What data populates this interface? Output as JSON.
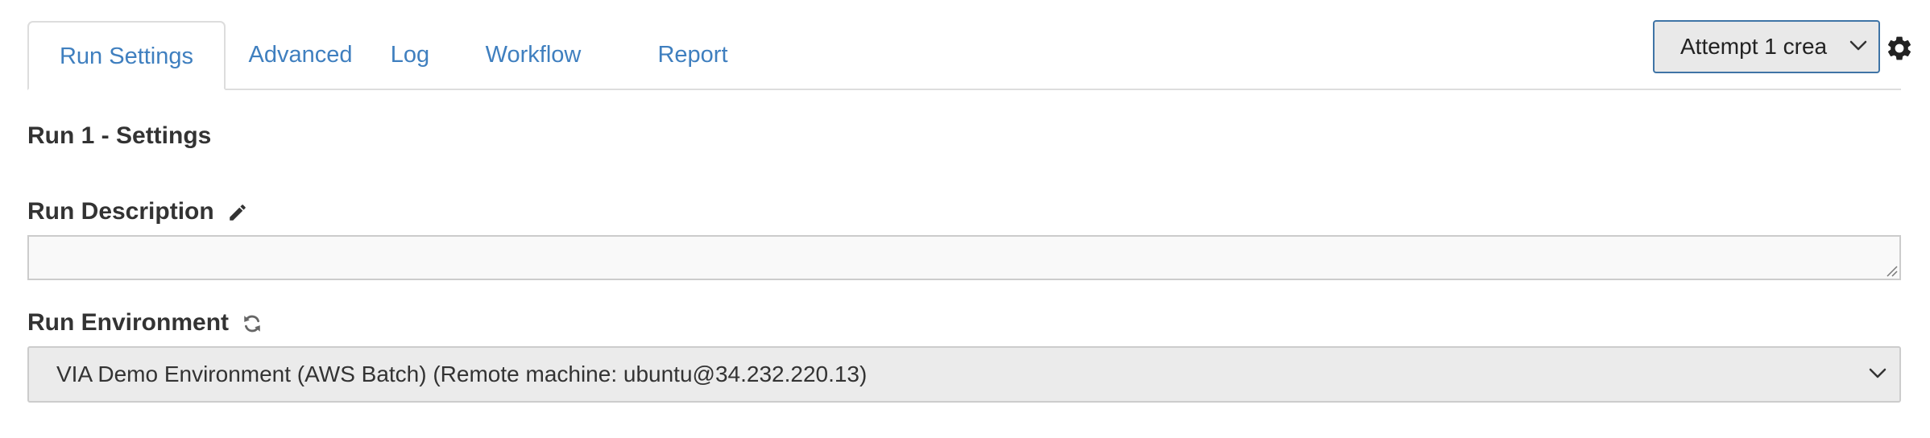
{
  "tabs": [
    {
      "label": "Run Settings",
      "active": true
    },
    {
      "label": "Advanced",
      "active": false
    },
    {
      "label": "Log",
      "active": false
    },
    {
      "label": "Workflow",
      "active": false
    },
    {
      "label": "Report",
      "active": false
    }
  ],
  "attempt_select": {
    "selected": "Attempt 1 crea"
  },
  "section_title": "Run 1 - Settings",
  "run_description": {
    "label": "Run Description",
    "value": "",
    "icon": "pencil-icon"
  },
  "run_environment": {
    "label": "Run Environment",
    "icon": "refresh-icon",
    "selected": "VIA Demo Environment (AWS Batch) (Remote machine: ubuntu@34.232.220.13)"
  },
  "icons": {
    "settings": "gear-icon"
  },
  "colors": {
    "link": "#3f7fbf",
    "select_border": "#3f74a6",
    "border": "#dddddd",
    "text": "#333333"
  }
}
